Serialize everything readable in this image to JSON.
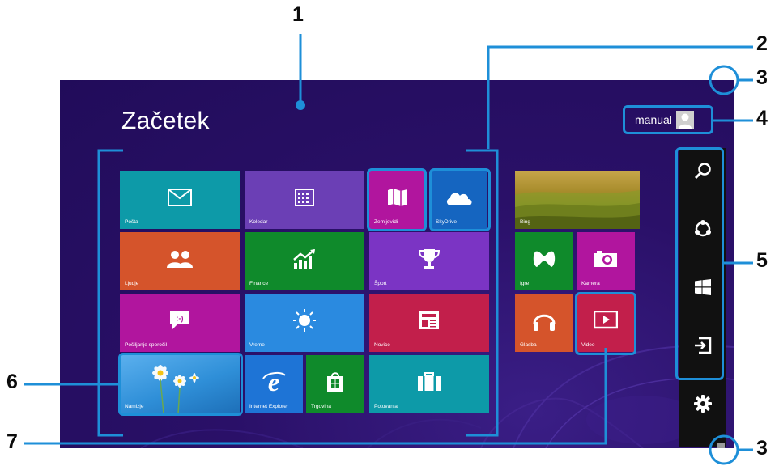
{
  "start_screen": {
    "title": "Začetek",
    "user_name": "manual"
  },
  "tiles": {
    "mail": "Pošta",
    "calendar": "Koledar",
    "maps": "Zemljevidi",
    "skydrive": "SkyDrive",
    "people": "Ljudje",
    "finance": "Finance",
    "sport": "Šport",
    "messaging": "Pošiljanje sporočil",
    "weather": "Vreme",
    "news": "Novice",
    "desktop": "Namizje",
    "ie": "Internet Explorer",
    "store": "Trgovina",
    "travel": "Potovanja",
    "bing": "Bing",
    "games": "Igre",
    "camera": "Kamera",
    "music": "Glasba",
    "video": "Video"
  },
  "tile_colors": {
    "teal": "#0d9aa8",
    "purple": "#6b3fb5",
    "magenta": "#b1159e",
    "blue": "#1565c0",
    "orange": "#d5542b",
    "green": "#0f8a2b",
    "violet": "#7b34c4",
    "sky": "#2a8ae0",
    "red": "#c21f4b",
    "desktop_bg": "#2f8fd8",
    "cyan": "#0d9aa8"
  },
  "charms": [
    "search-icon",
    "share-icon",
    "start-icon",
    "devices-icon",
    "settings-icon"
  ],
  "callouts": {
    "c1": "1",
    "c2": "2",
    "c3a": "3",
    "c3b": "3",
    "c4": "4",
    "c5": "5",
    "c6": "6",
    "c7": "7"
  },
  "colors": {
    "callout_blue": "#1e8fd8",
    "background": "#210c5a",
    "callout_text": "#0b0b0b"
  }
}
